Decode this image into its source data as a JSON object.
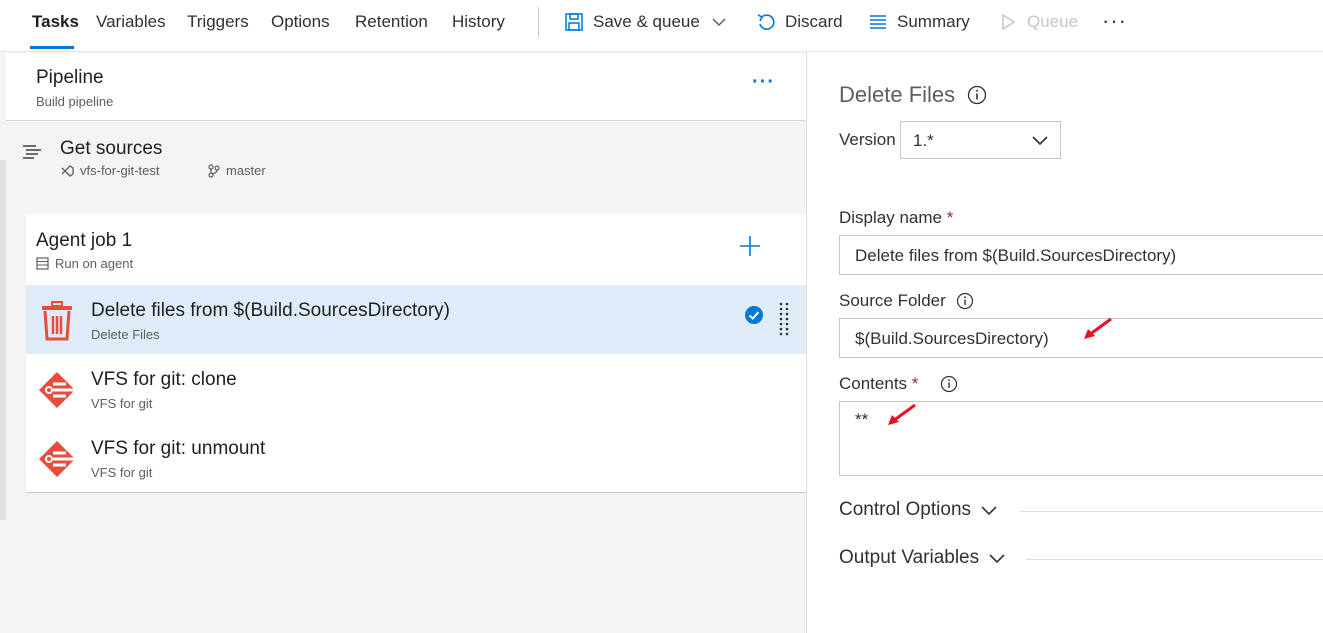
{
  "toolbar": {
    "tabs": [
      {
        "label": "Tasks",
        "active": true
      },
      {
        "label": "Variables"
      },
      {
        "label": "Triggers"
      },
      {
        "label": "Options"
      },
      {
        "label": "Retention"
      },
      {
        "label": "History"
      }
    ],
    "save_label": "Save & queue",
    "discard_label": "Discard",
    "summary_label": "Summary",
    "queue_label": "Queue",
    "more_label": "···"
  },
  "pipeline": {
    "title": "Pipeline",
    "subtitle": "Build pipeline",
    "more_label": "···"
  },
  "sources": {
    "title": "Get sources",
    "repo": "vfs-for-git-test",
    "branch": "master"
  },
  "job": {
    "title": "Agent job 1",
    "subtitle": "Run on agent",
    "tasks": [
      {
        "title": "Delete files from $(Build.SourcesDirectory)",
        "subtitle": "Delete Files",
        "selected": true
      },
      {
        "title": "VFS for git: clone",
        "subtitle": "VFS for git"
      },
      {
        "title": "VFS for git: unmount",
        "subtitle": "VFS for git"
      }
    ]
  },
  "details": {
    "title": "Delete Files",
    "version_label": "Version",
    "version_value": "1.*",
    "display_name_label": "Display name",
    "display_name_value": "Delete files from $(Build.SourcesDirectory)",
    "source_folder_label": "Source Folder",
    "source_folder_value": "$(Build.SourcesDirectory)",
    "contents_label": "Contents",
    "contents_value": "**",
    "required_mark": "*",
    "control_options_label": "Control Options",
    "output_variables_label": "Output Variables"
  },
  "colors": {
    "accent": "#0078d4",
    "selected_row": "#deecf9",
    "delete_icon": "#e74c3c",
    "vfs_icon": "#e74c3c",
    "annotation_arrow": "#e81123"
  }
}
